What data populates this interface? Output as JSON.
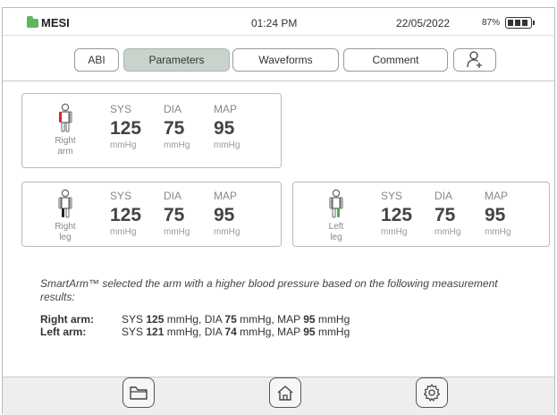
{
  "status": {
    "brand": "MESI",
    "time": "01:24 PM",
    "date": "22/05/2022",
    "battery": "87%"
  },
  "tabs": {
    "abi": "ABI",
    "parameters": "Parameters",
    "waveforms": "Waveforms",
    "comment": "Comment",
    "active": "Parameters",
    "add_user_icon": "add-user-icon"
  },
  "measurements": {
    "right_arm": {
      "limb_line1": "Right",
      "limb_line2": "arm",
      "sys_label": "SYS",
      "dia_label": "DIA",
      "map_label": "MAP",
      "sys": "125",
      "dia": "75",
      "map": "95",
      "unit": "mmHg",
      "highlight_color": "#d9262b"
    },
    "right_leg": {
      "limb_line1": "Right",
      "limb_line2": "leg",
      "sys_label": "SYS",
      "dia_label": "DIA",
      "map_label": "MAP",
      "sys": "125",
      "dia": "75",
      "map": "95",
      "unit": "mmHg",
      "highlight_color": "#222222"
    },
    "left_leg": {
      "limb_line1": "Left",
      "limb_line2": "leg",
      "sys_label": "SYS",
      "dia_label": "DIA",
      "map_label": "MAP",
      "sys": "125",
      "dia": "75",
      "map": "95",
      "unit": "mmHg",
      "highlight_color": "#4caf50"
    }
  },
  "smartarm_note": "SmartArm™  selected the arm with a higher blood pressure based on the following measurement results:",
  "results": {
    "right": {
      "label": "Right arm:",
      "sys": "125",
      "dia": "75",
      "map": "95"
    },
    "left": {
      "label": "Left arm:",
      "sys": "121",
      "dia": "74",
      "map": "95"
    },
    "sys_prefix": "SYS ",
    "dia_prefix": "DIA ",
    "map_prefix": "MAP ",
    "unit_comma": " mmHg, ",
    "unit": " mmHg"
  },
  "nav": {
    "files_icon": "folder-icon",
    "home_icon": "home-icon",
    "settings_icon": "gear-icon"
  },
  "colors": {
    "brand_green": "#5cb85c",
    "active_tab": "#c8d3cc"
  }
}
